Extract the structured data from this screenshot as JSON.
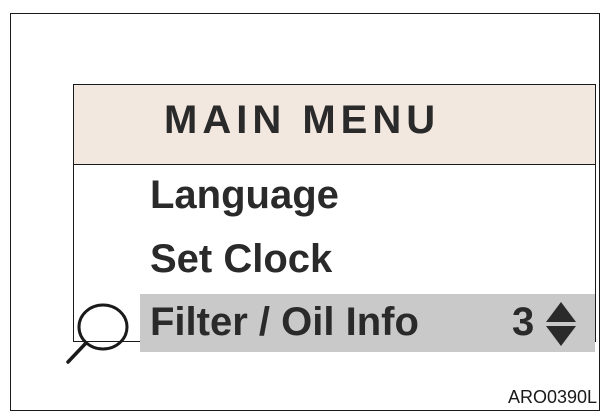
{
  "menu": {
    "title": "MAIN MENU",
    "items": [
      {
        "label": "Language"
      },
      {
        "label": "Set Clock"
      },
      {
        "label": "Filter / Oil Info",
        "count": "3",
        "selected": true
      }
    ]
  },
  "figure_code": "ARO0390L",
  "icons": {
    "selector": "magnifier-icon",
    "scroll": "up-down-arrows-icon"
  },
  "colors": {
    "title_bar": "#f3e8e0",
    "selected_row": "#c9c9c9",
    "text": "#2a2a2a"
  }
}
